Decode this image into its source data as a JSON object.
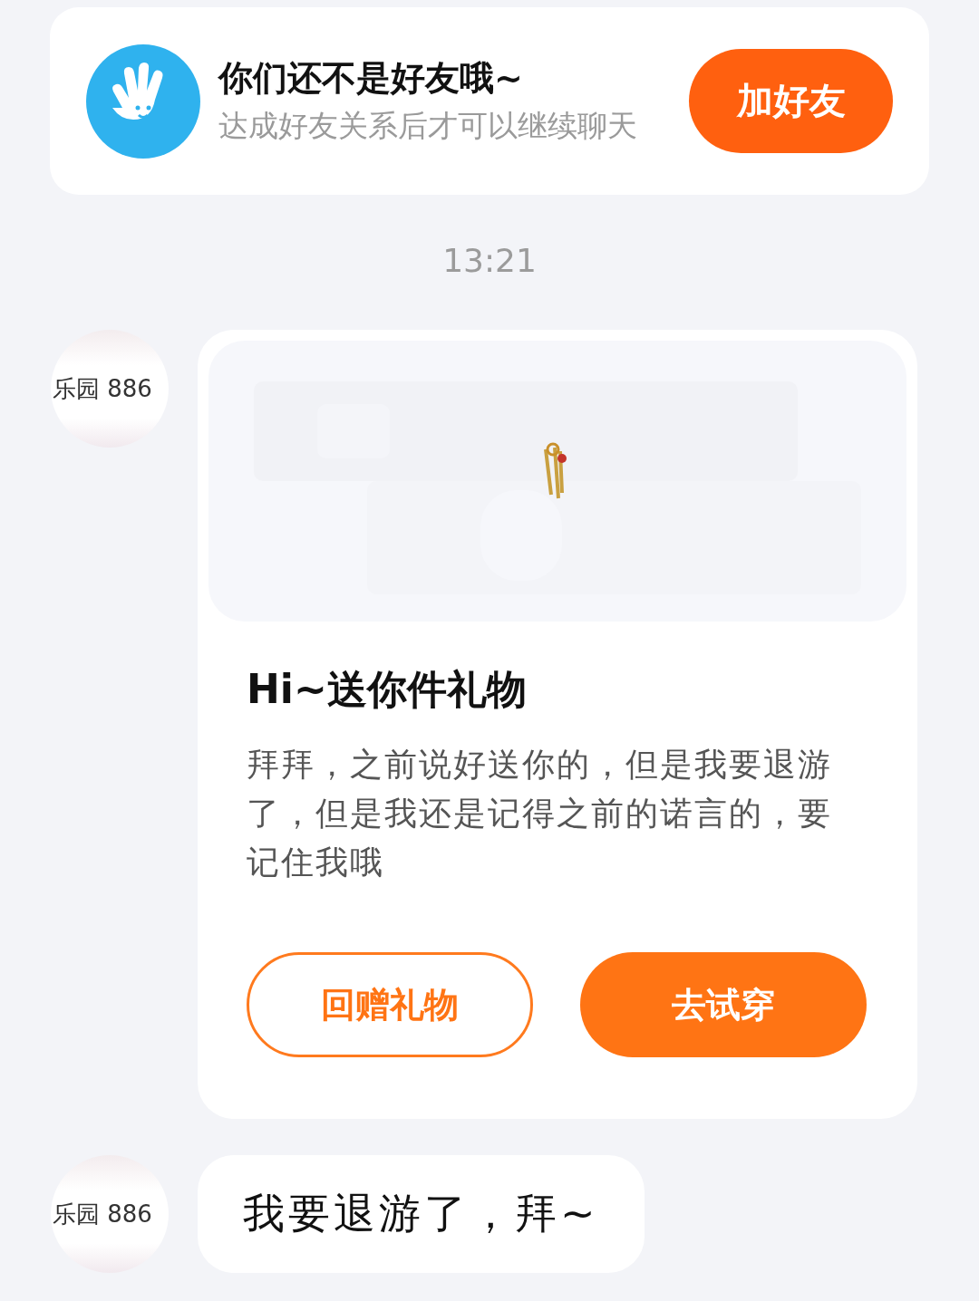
{
  "friend_notice": {
    "title": "你们还不是好友哦~",
    "subtitle": "达成好友关系后才可以继续聊天",
    "button": "加好友"
  },
  "timestamp": "13:21",
  "messages": [
    {
      "kind": "gift",
      "avatar_label": "乐园 886",
      "title": "Hi~送你件礼物",
      "body": "拜拜，之前说好送你的，但是我要退游了，但是我还是记得之前的诺言的，要记住我哦",
      "buttons": [
        {
          "label": "回赠礼物",
          "kind": "outline"
        },
        {
          "label": "去试穿",
          "kind": "filled"
        }
      ]
    },
    {
      "kind": "text",
      "avatar_label": "乐园 886",
      "text": "我要退游了，拜~"
    }
  ]
}
